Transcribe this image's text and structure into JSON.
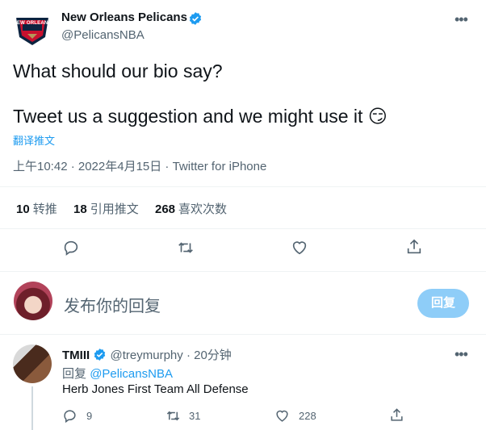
{
  "tweet": {
    "author_name": "New Orleans Pelicans",
    "author_handle": "@PelicansNBA",
    "logo_text": "NEW ORLEANS",
    "text_line1": "What should our bio say?",
    "text_line2": "Tweet us a suggestion and we might use it",
    "emoji": "😏",
    "translate": "翻译推文",
    "timestamp": "上午10:42 · 2022年4月15日 · Twitter for iPhone",
    "stats": [
      {
        "num": "10",
        "label": "转推"
      },
      {
        "num": "18",
        "label": "引用推文"
      },
      {
        "num": "268",
        "label": "喜欢次数"
      }
    ]
  },
  "compose": {
    "placeholder": "发布你的回复",
    "reply_button": "回复"
  },
  "reply": {
    "name": "TMIII",
    "handle": "@treymurphy",
    "time": "· 20分钟",
    "reply_to_prefix": "回复",
    "reply_to": "@PelicansNBA",
    "text": "Herb Jones First Team All Defense",
    "counts": {
      "reply": "9",
      "retweet": "31",
      "like": "228"
    }
  },
  "colors": {
    "accent": "#1d9bf0",
    "reply_button_disabled": "#8ecdf8"
  }
}
